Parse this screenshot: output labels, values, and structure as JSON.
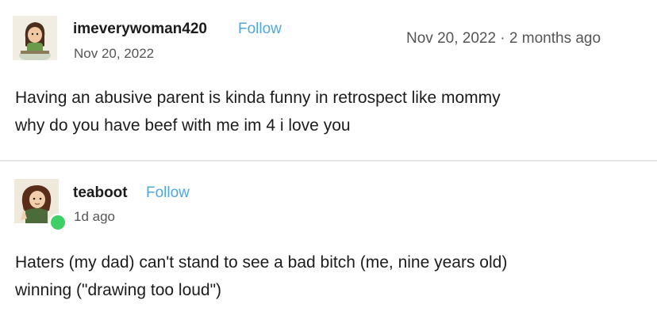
{
  "posts": [
    {
      "username": "imeverywoman420",
      "follow_label": "Follow",
      "date": "Nov 20, 2022",
      "top_date": "Nov 20, 2022 · 2 months ago",
      "body_line1": "Having an abusive parent is kinda funny in retrospect like mommy",
      "body_line2": "why do you have beef with me im 4 i love you",
      "avatar_icon": "avatar-icon"
    },
    {
      "username": "teaboot",
      "follow_label": "Follow",
      "date": "1d ago",
      "body_line1": "Haters (my dad) can't stand to see a bad bitch (me, nine years old)",
      "body_line2": "winning (\"drawing too loud\")",
      "avatar_icon": "avatar-icon",
      "badge_icon": "online-badge-icon"
    }
  ],
  "colors": {
    "follow": "#4fa8dc",
    "badge": "#3ecf66",
    "divider": "#e6e6e6"
  }
}
